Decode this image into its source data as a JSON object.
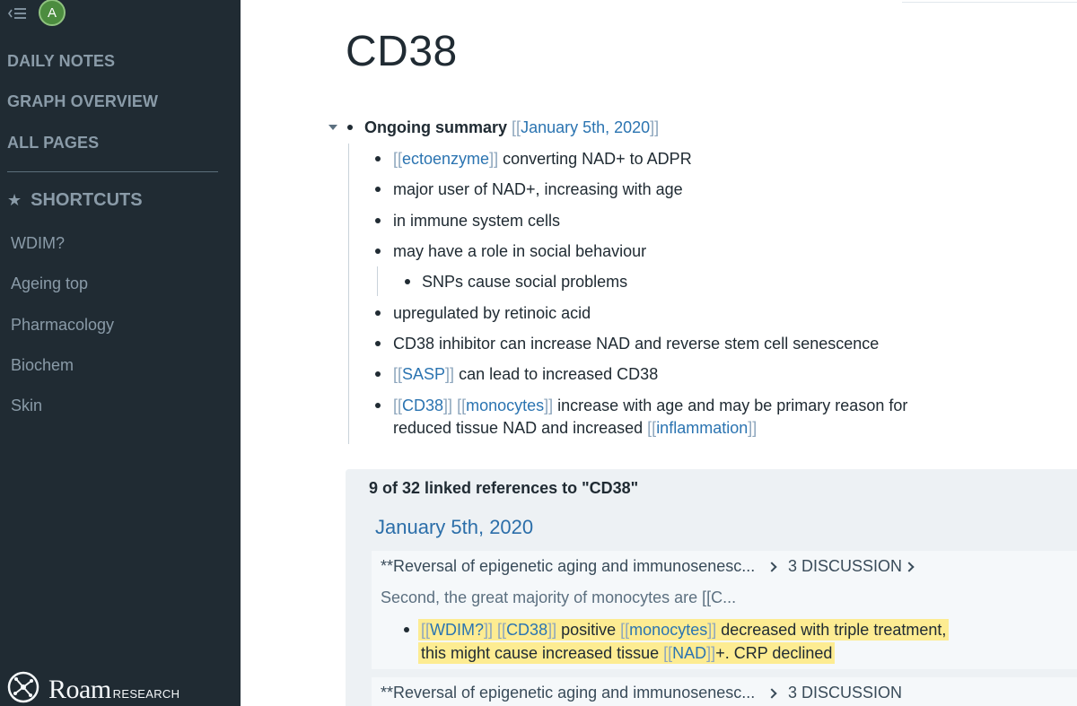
{
  "sidebar": {
    "avatar_initial": "A",
    "nav": [
      "DAILY NOTES",
      "GRAPH OVERVIEW",
      "ALL PAGES"
    ],
    "shortcuts_title": "SHORTCUTS",
    "shortcuts": [
      "WDIM?",
      "Ageing top",
      "Pharmacology",
      "Biochem",
      "Skin"
    ],
    "logo_word": "Roam",
    "logo_sub": "RESEARCH"
  },
  "page": {
    "title": "CD38"
  },
  "blocks": {
    "root_bold": "Ongoing summary",
    "root_link": "January 5th, 2020",
    "b1_link": "ectoenzyme",
    "b1_text": " converting NAD+ to ADPR",
    "b2": "major user of NAD+, increasing with age",
    "b3": "in immune system cells",
    "b4": "may have a role in social behaviour",
    "b4_child": "SNPs cause social problems",
    "b5": "upregulated by retinoic acid",
    "b6": "CD38 inhibitor can increase NAD and reverse stem cell senescence",
    "b7_link": "SASP",
    "b7_text": " can lead to increased CD38",
    "b8_link1": "CD38",
    "b8_link2": "monocytes",
    "b8_text1": " increase with age and may be primary reason for",
    "b8_text2": "reduced tissue NAD and increased ",
    "b8_link3": "inflammation"
  },
  "refs": {
    "count_label": "9 of 32 linked references to \"CD38\"",
    "date": "January 5th, 2020",
    "card1_breadcrumb_a": "**Reversal of epigenetic aging and immunosenesc...",
    "card1_breadcrumb_b": "3 DISCUSSION",
    "card1_snippet": "Second, the great majority of monocytes are [[C...",
    "card1_link1": "WDIM?",
    "card1_link2": "CD38",
    "card1_text1": " positive ",
    "card1_link3": "monocytes",
    "card1_text2": " decreased with triple treatment,",
    "card1_text3": "this might cause increased tissue ",
    "card1_link4": "NAD",
    "card1_text4": "+. CRP declined",
    "card2_breadcrumb_a": "**Reversal of epigenetic aging and immunosenesc...",
    "card2_breadcrumb_b": "3 DISCUSSION"
  },
  "colors": {
    "sidebar_bg": "#202b33",
    "link": "#2b74b1",
    "bracket": "#8da6bd",
    "highlight": "#fdec92"
  }
}
